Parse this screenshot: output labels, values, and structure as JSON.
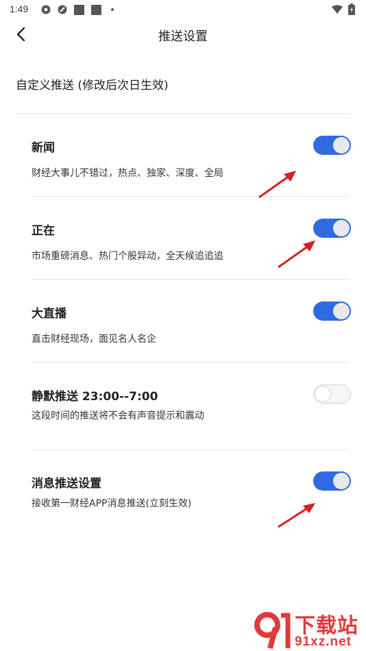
{
  "status_bar": {
    "time": "1:49"
  },
  "header": {
    "title": "推送设置"
  },
  "section": {
    "label": "自定义推送 (修改后次日生效)"
  },
  "settings": [
    {
      "title": "新闻",
      "description": "财经大事儿不错过，热点、独家、深度、全局",
      "enabled": true
    },
    {
      "title": "正在",
      "description": "市场重磅消息、热门个股异动，全天候追追追",
      "enabled": true
    },
    {
      "title": "大直播",
      "description": "直击财经现场，面见名人名企",
      "enabled": true
    },
    {
      "title": "静默推送 23:00--7:00",
      "description": "这段时间的推送将不会有声音提示和震动",
      "enabled": false
    },
    {
      "title": "消息推送设置",
      "description": "接收第一财经APP消息推送(立刻生效)",
      "enabled": true
    }
  ],
  "watermark": {
    "brand": "下载站",
    "domain": "91xz.net"
  },
  "colors": {
    "accent": "#2f6ae0",
    "annotation_arrow": "#d42020",
    "watermark": "#e23a3a"
  }
}
